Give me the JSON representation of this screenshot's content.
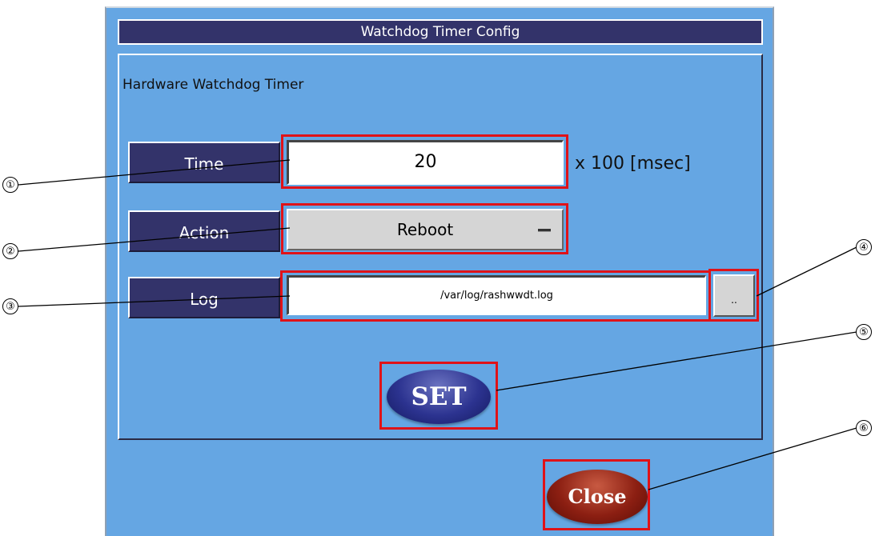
{
  "window": {
    "title": "Watchdog Timer Config"
  },
  "group": {
    "title": "Hardware Watchdog Timer"
  },
  "fields": {
    "time": {
      "label": "Time",
      "value": "20",
      "unit": "x 100 [msec]"
    },
    "action": {
      "label": "Action",
      "value": "Reboot"
    },
    "log": {
      "label": "Log",
      "value": "/var/log/rashwwdt.log",
      "browse_label": ".."
    }
  },
  "buttons": {
    "set": "SET",
    "close": "Close"
  },
  "callouts": [
    "①",
    "②",
    "③",
    "④",
    "⑤",
    "⑥"
  ],
  "colors": {
    "window_bg": "#65a6e3",
    "title_bg": "#33336a",
    "highlight": "#e01218",
    "set_button": "#2c3390",
    "close_button": "#8c1f12"
  }
}
